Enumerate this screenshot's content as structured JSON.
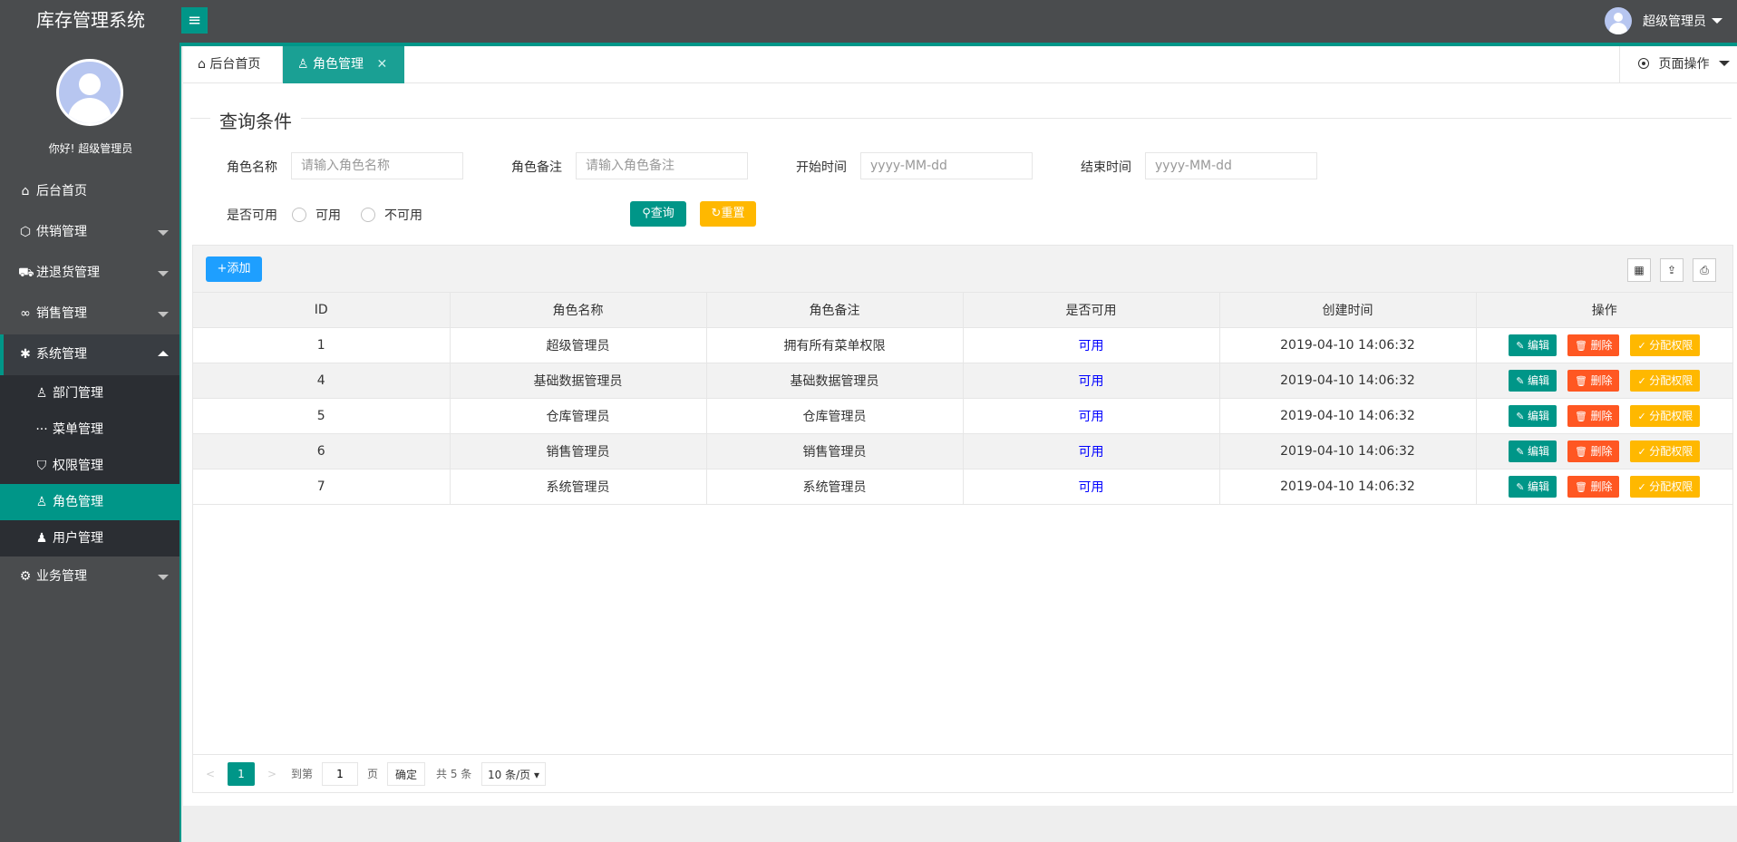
{
  "header": {
    "app_title": "库存管理系统",
    "username": "超级管理员"
  },
  "sidebar": {
    "greeting": "你好! 超级管理员",
    "items": [
      {
        "label": "后台首页",
        "icon": "home-icon"
      },
      {
        "label": "供销管理",
        "icon": "cube-icon"
      },
      {
        "label": "进退货管理",
        "icon": "cart-icon"
      },
      {
        "label": "销售管理",
        "icon": "link-icon"
      },
      {
        "label": "系统管理",
        "icon": "gear-icon"
      },
      {
        "label": "业务管理",
        "icon": "settings-icon"
      }
    ],
    "subitems": [
      {
        "label": "部门管理",
        "icon": "user-outline-icon"
      },
      {
        "label": "菜单管理",
        "icon": "dots-icon"
      },
      {
        "label": "权限管理",
        "icon": "shield-icon"
      },
      {
        "label": "角色管理",
        "icon": "user-outline-icon"
      },
      {
        "label": "用户管理",
        "icon": "user-solid-icon"
      }
    ]
  },
  "tabs": {
    "home": "后台首页",
    "active": "角色管理",
    "page_ops": "页面操作"
  },
  "query": {
    "title": "查询条件",
    "role_name_label": "角色名称",
    "role_name_placeholder": "请输入角色名称",
    "role_remark_label": "角色备注",
    "role_remark_placeholder": "请输入角色备注",
    "start_time_label": "开始时间",
    "start_time_placeholder": "yyyy-MM-dd",
    "end_time_label": "结束时间",
    "end_time_placeholder": "yyyy-MM-dd",
    "available_label": "是否可用",
    "opt_available": "可用",
    "opt_unavailable": "不可用",
    "search_btn": "查询",
    "reset_btn": "重置"
  },
  "table": {
    "add_btn": "添加",
    "columns": [
      "ID",
      "角色名称",
      "角色备注",
      "是否可用",
      "创建时间",
      "操作"
    ],
    "rows": [
      {
        "id": "1",
        "name": "超级管理员",
        "remark": "拥有所有菜单权限",
        "available": "可用",
        "created": "2019-04-10 14:06:32"
      },
      {
        "id": "4",
        "name": "基础数据管理员",
        "remark": "基础数据管理员",
        "available": "可用",
        "created": "2019-04-10 14:06:32"
      },
      {
        "id": "5",
        "name": "仓库管理员",
        "remark": "仓库管理员",
        "available": "可用",
        "created": "2019-04-10 14:06:32"
      },
      {
        "id": "6",
        "name": "销售管理员",
        "remark": "销售管理员",
        "available": "可用",
        "created": "2019-04-10 14:06:32"
      },
      {
        "id": "7",
        "name": "系统管理员",
        "remark": "系统管理员",
        "available": "可用",
        "created": "2019-04-10 14:06:32"
      }
    ],
    "edit_btn": "编辑",
    "delete_btn": "删除",
    "assign_btn": "分配权限"
  },
  "pager": {
    "current": "1",
    "goto_label": "到第",
    "goto_value": "1",
    "page_unit": "页",
    "confirm": "确定",
    "total": "共 5 条",
    "page_size": "10 条/页"
  },
  "colors": {
    "accent": "#009688",
    "warning": "#ffb800",
    "danger": "#ff5722",
    "primary": "#1e9fff"
  }
}
